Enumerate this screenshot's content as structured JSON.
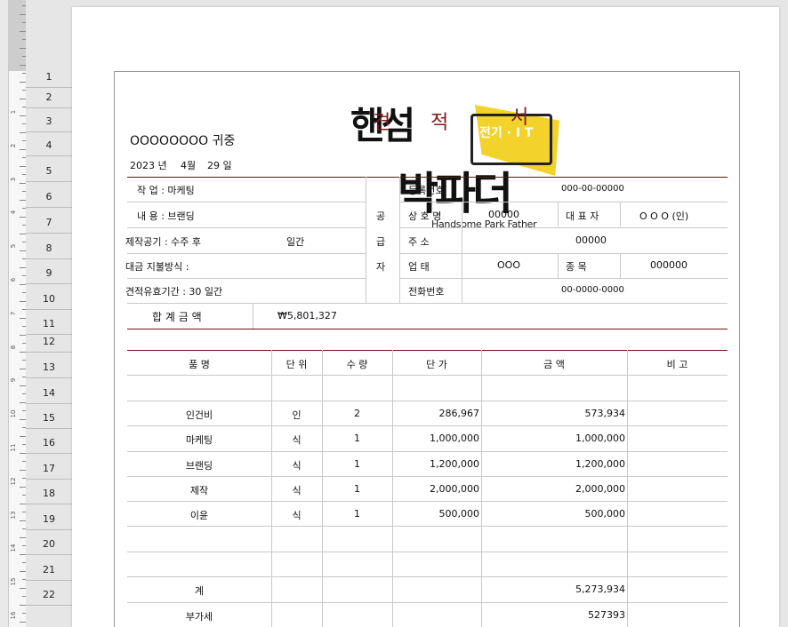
{
  "row_numbers": [
    "1",
    "2",
    "3",
    "4",
    "5",
    "6",
    "7",
    "8",
    "9",
    "10",
    "11",
    "12",
    "13",
    "14",
    "15",
    "16",
    "17",
    "18",
    "19",
    "20",
    "21",
    "22"
  ],
  "ruler_numbers": [
    "1",
    "2",
    "3",
    "4",
    "5",
    "6",
    "7",
    "8",
    "9",
    "10",
    "11",
    "12",
    "13",
    "14",
    "15",
    "16"
  ],
  "stamp": {
    "line1": "핸섬",
    "line1b": "견",
    "line1c": "적",
    "tag": "전기 · I T",
    "line2": "박파더",
    "line2b": "서",
    "english": "Handsome Park Father"
  },
  "recipient": "OOOOOOOO 귀중",
  "date": {
    "year": "2023 년",
    "month": "4월",
    "day": "29 일"
  },
  "left_info": {
    "work": "작      업  : 마케팅",
    "content": "내      용  : 브랜딩",
    "period": "제작공기 : 수주  후",
    "period_days": "일간",
    "payment": "대금 지불방식 :",
    "valid": "견적유효기간 :   30  일간"
  },
  "supplier": {
    "label": [
      "공",
      "급",
      "자"
    ],
    "reg_label": "등록번호",
    "reg_value": "000-00-00000",
    "name_label": "상 호 명",
    "name_value": "00000",
    "ceo_label": "대 표 자",
    "ceo_value": "O O O  (인)",
    "addr_label": "주      소",
    "addr_value": "00000",
    "biz_label": "업      태",
    "biz_value": "OOO",
    "type_label": "종      목",
    "type_value": "000000",
    "phone_label": "전화번호",
    "phone_value": "00-0000-0000"
  },
  "total": {
    "label": "합  계  금  액",
    "value": "₩5,801,327"
  },
  "table": {
    "headers": [
      "품          명",
      "단  위",
      "수  량",
      "단      가",
      "금          액",
      "비      고"
    ],
    "rows": [
      [
        "인건비",
        "인",
        "2",
        "286,967",
        "573,934",
        ""
      ],
      [
        "마케팅",
        "식",
        "1",
        "1,000,000",
        "1,000,000",
        ""
      ],
      [
        "브랜딩",
        "식",
        "1",
        "1,200,000",
        "1,200,000",
        ""
      ],
      [
        "제작",
        "식",
        "1",
        "2,000,000",
        "2,000,000",
        ""
      ],
      [
        "이윤",
        "식",
        "1",
        "500,000",
        "500,000",
        ""
      ]
    ],
    "subtotal_label": "계",
    "subtotal_value": "5,273,934",
    "vat_label": "부가세",
    "vat_value": "527393"
  }
}
